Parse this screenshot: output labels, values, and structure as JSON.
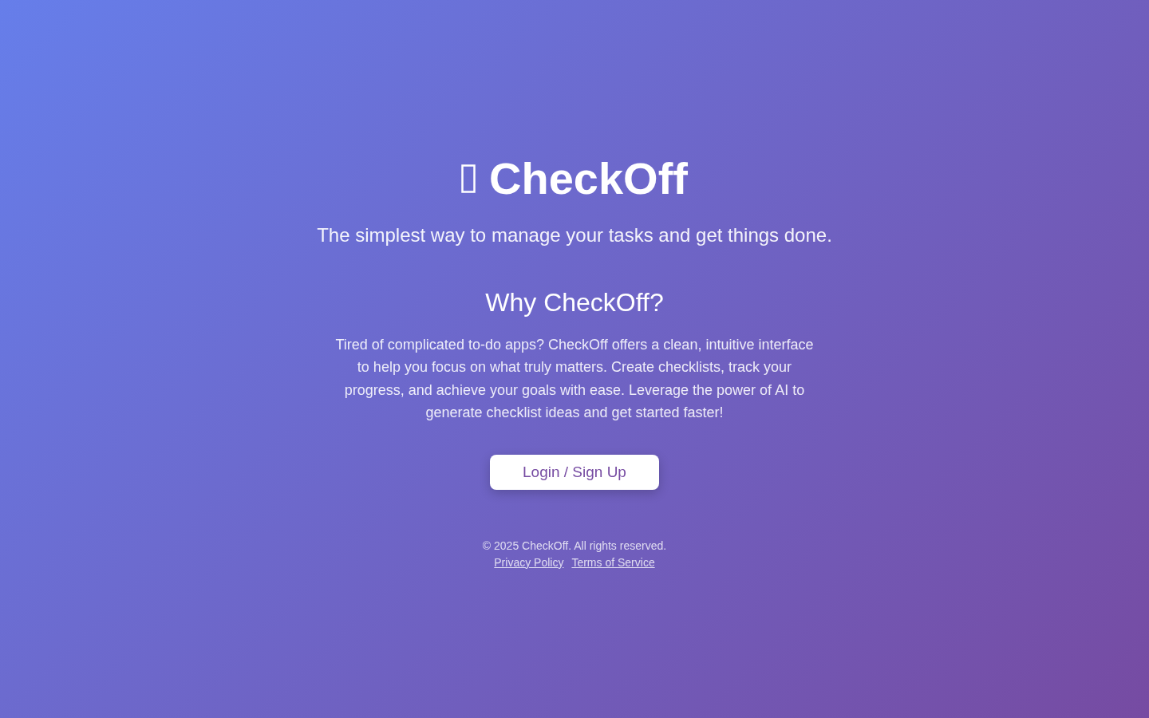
{
  "hero": {
    "title": "CheckOff",
    "tagline": "The simplest way to manage your tasks and get things done."
  },
  "about": {
    "heading": "Why CheckOff?",
    "body": "Tired of complicated to-do apps? CheckOff offers a clean, intuitive interface to help you focus on what truly matters. Create checklists, track your progress, and achieve your goals with ease. Leverage the power of AI to generate checklist ideas and get started faster!"
  },
  "cta": {
    "label": "Login / Sign Up"
  },
  "footer": {
    "copyright": "© 2025 CheckOff. All rights reserved.",
    "links": [
      "Privacy Policy",
      "Terms of Service"
    ]
  }
}
